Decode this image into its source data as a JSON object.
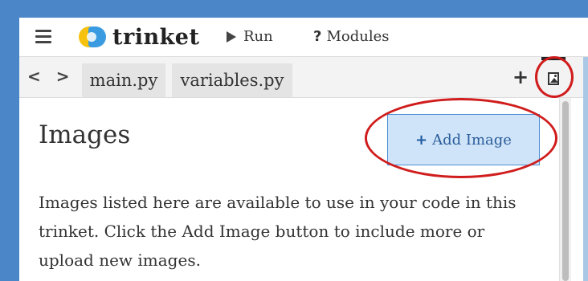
{
  "header": {
    "logo_text": "trinket",
    "run_label": "Run",
    "modules_icon": "?",
    "modules_label": "Modules"
  },
  "tabs": [
    {
      "label": "main.py"
    },
    {
      "label": "variables.py"
    }
  ],
  "nav": {
    "arrows": "< >"
  },
  "toolbar": {
    "add_file": "+"
  },
  "images_panel": {
    "title": "Images",
    "add_button_icon": "+",
    "add_button_label": "Add Image",
    "description": "Images listed here are available to use in your code in this trinket. Click the Add Image button to include more or upload new images."
  },
  "icons": {
    "menu": "hamburger-icon",
    "run": "play-icon",
    "image_tab": "image-icon"
  },
  "colors": {
    "annotation_circle": "#d01c1c",
    "add_button_bg": "#cfe4f8",
    "add_button_border": "#4a8fd4",
    "page_background": "#4a86c8"
  }
}
